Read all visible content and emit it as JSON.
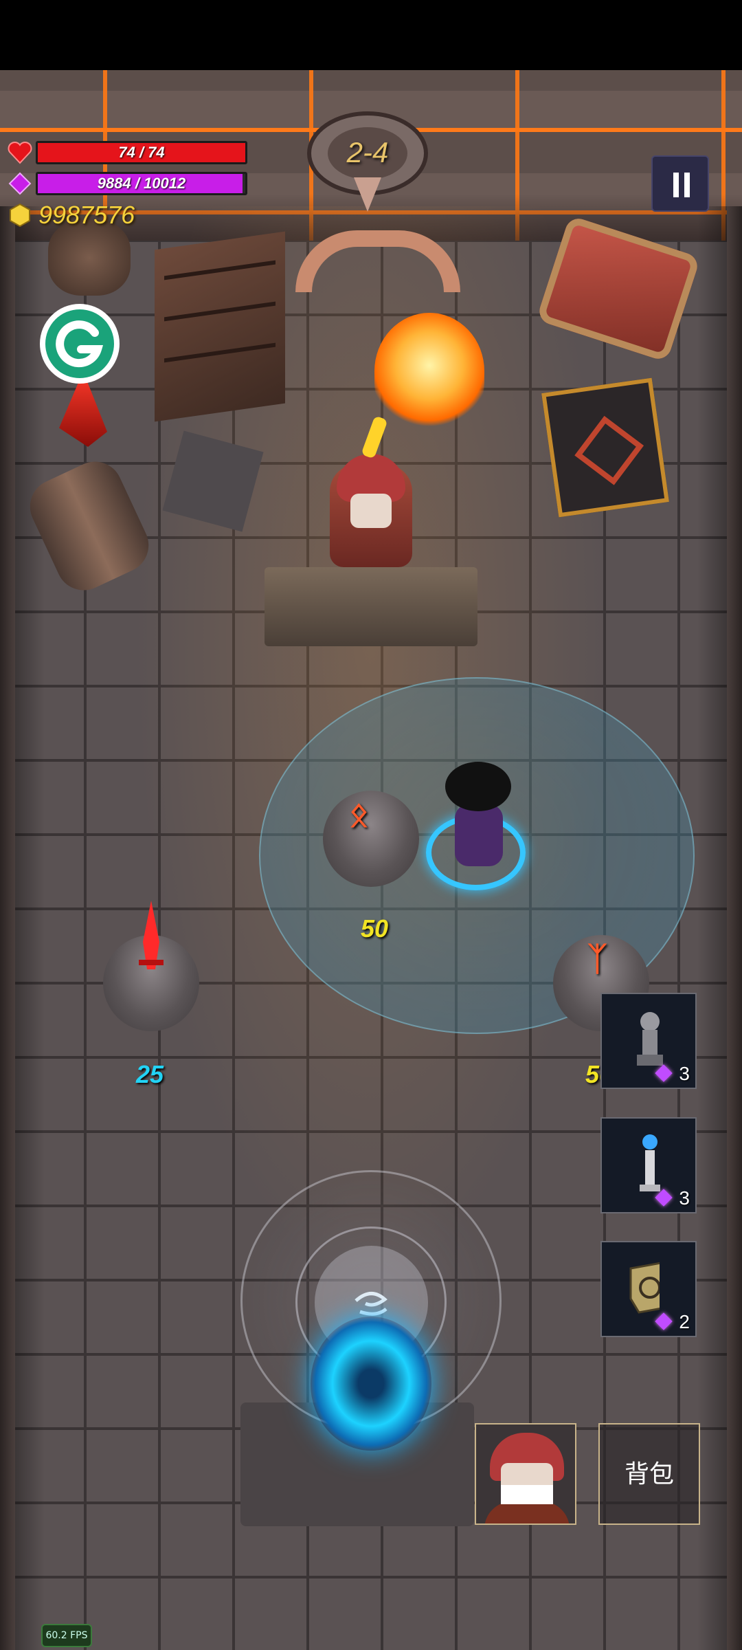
{
  "hud": {
    "health": {
      "text": "74 / 74",
      "current": 74,
      "max": 74,
      "color": "#e5141b"
    },
    "mana": {
      "text": "9884 / 10012",
      "current": 9884,
      "max": 10012,
      "color": "#c81ee8"
    },
    "gold": {
      "text": "9987576"
    }
  },
  "level": {
    "label": "2-4"
  },
  "pause": {
    "icon": "pause-icon"
  },
  "g_button": {
    "label": "G",
    "color": "#1aa37a"
  },
  "pedestals": [
    {
      "id": "red",
      "rune_icon": "sword-rune-icon",
      "cost": "25",
      "cost_color": "#22d3f5"
    },
    {
      "id": "center",
      "rune": "ᛟ",
      "cost": "50",
      "cost_color": "#f2e424"
    },
    {
      "id": "right",
      "rune": "ᛉ",
      "cost": "50",
      "cost_color": "#f2e424"
    }
  ],
  "item_slots": [
    {
      "icon": "statue-icon",
      "count": "3"
    },
    {
      "icon": "lamp-pillar-icon",
      "count": "3"
    },
    {
      "icon": "rune-box-icon",
      "count": "2"
    }
  ],
  "bag_button": {
    "label": "背包"
  },
  "portrait_button": {
    "icon": "merchant-portrait-icon"
  },
  "fps": {
    "text": "60.2 FPS"
  }
}
